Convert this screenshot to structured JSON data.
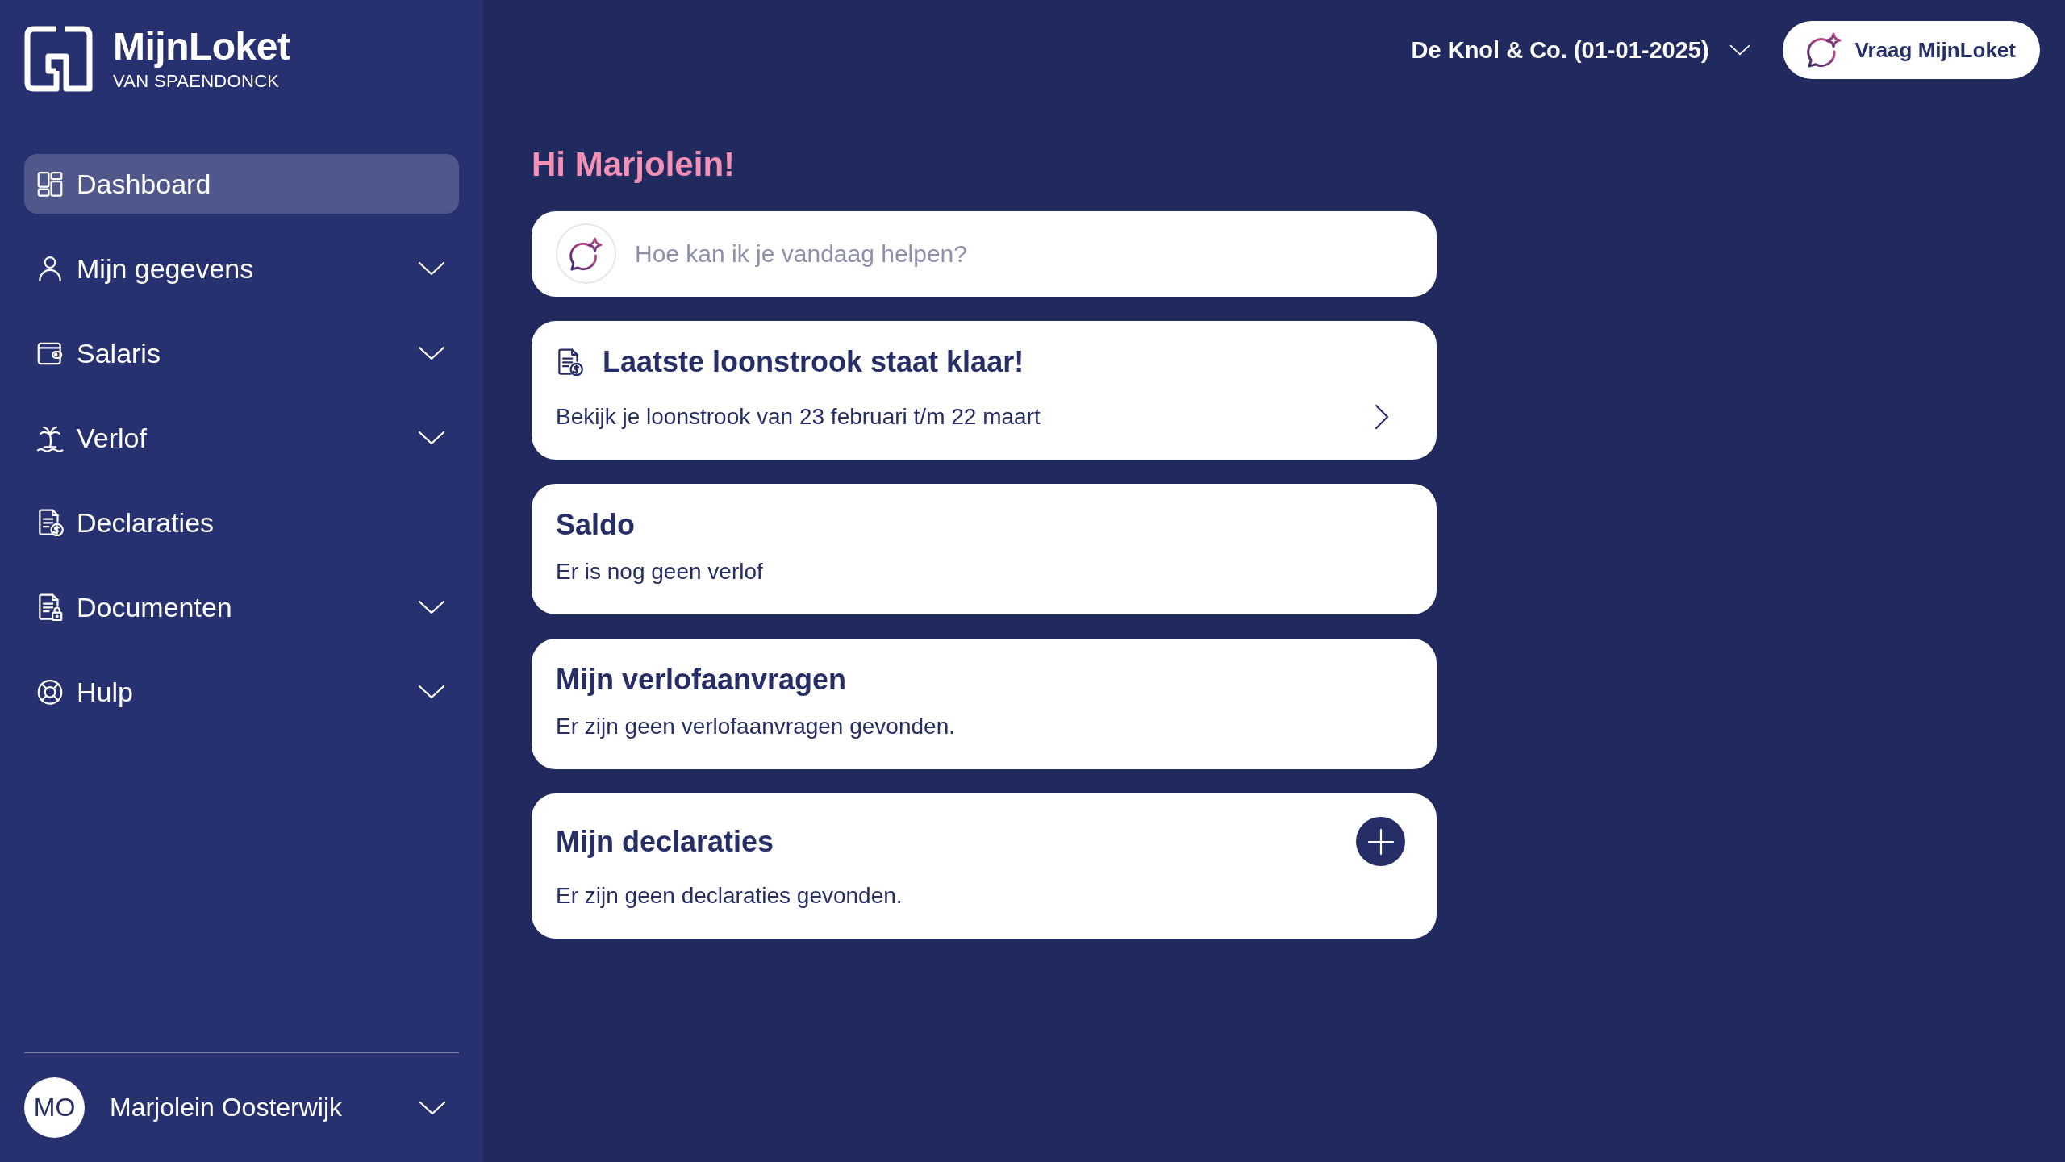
{
  "logo": {
    "title": "MijnLoket",
    "subtitle": "VAN SPAENDONCK"
  },
  "sidebar": {
    "items": [
      {
        "label": "Dashboard",
        "kind": "link",
        "selected": true
      },
      {
        "label": "Mijn gegevens",
        "kind": "group",
        "selected": false
      },
      {
        "label": "Salaris",
        "kind": "group",
        "selected": false
      },
      {
        "label": "Verlof",
        "kind": "group",
        "selected": false
      },
      {
        "label": "Declaraties",
        "kind": "link",
        "selected": false
      },
      {
        "label": "Documenten",
        "kind": "group",
        "selected": false
      },
      {
        "label": "Hulp",
        "kind": "group",
        "selected": false
      }
    ]
  },
  "user": {
    "initials": "MO",
    "name": "Marjolein Oosterwijk"
  },
  "header": {
    "employer": "De Knol & Co. (01-01-2025)",
    "ask_button": "Vraag MijnLoket"
  },
  "greeting": "Hi Marjolein!",
  "ask_field": {
    "placeholder": "Hoe kan ik je vandaag helpen?"
  },
  "cards": [
    {
      "kind": "link",
      "title": "Laatste loonstrook staat klaar!",
      "text": "Bekijk je loonstrook van 23 februari t/m 22 maart"
    },
    {
      "kind": "plain",
      "title": "Saldo",
      "text": "Er is nog geen verlof"
    },
    {
      "kind": "plain",
      "title": "Mijn verlofaanvragen",
      "text": "Er zijn geen verlofaanvragen gevonden."
    },
    {
      "kind": "add",
      "title": "Mijn declaraties",
      "text": "Er zijn geen declaraties gevonden."
    }
  ]
}
